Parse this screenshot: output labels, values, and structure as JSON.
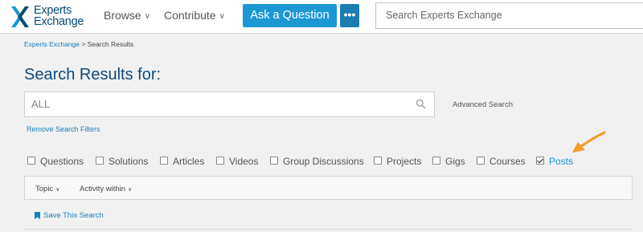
{
  "header": {
    "logo_line1": "Experts",
    "logo_line2": "Exchange",
    "nav": [
      {
        "label": "Browse"
      },
      {
        "label": "Contribute"
      }
    ],
    "ask_button": "Ask a Question",
    "more_button": "•••",
    "search_placeholder": "Search Experts Exchange"
  },
  "breadcrumb": {
    "home": "Experts Exchange",
    "separator": " > ",
    "current": "Search Results"
  },
  "page_title": "Search Results for:",
  "search": {
    "value": "ALL",
    "advanced_label": "Advanced Search",
    "remove_filters_label": "Remove Search Filters"
  },
  "filters": [
    {
      "label": "Questions",
      "checked": false
    },
    {
      "label": "Solutions",
      "checked": false
    },
    {
      "label": "Articles",
      "checked": false
    },
    {
      "label": "Videos",
      "checked": false
    },
    {
      "label": "Group Discussions",
      "checked": false
    },
    {
      "label": "Projects",
      "checked": false
    },
    {
      "label": "Gigs",
      "checked": false
    },
    {
      "label": "Courses",
      "checked": false
    },
    {
      "label": "Posts",
      "checked": true
    }
  ],
  "dropdowns": [
    {
      "label": "Topic"
    },
    {
      "label": "Activity within"
    }
  ],
  "save_search_label": "Save This Search",
  "colors": {
    "brand_blue": "#1b98d4",
    "title_blue": "#0d4a7a",
    "link_blue": "#1b7eb2",
    "arrow_orange": "#f39a2b"
  }
}
